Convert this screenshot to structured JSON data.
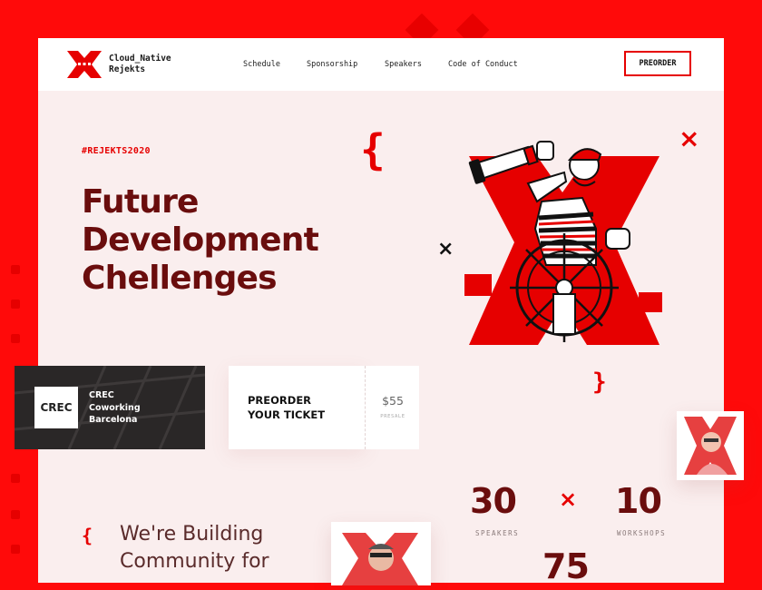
{
  "header": {
    "logo_line1": "Cloud_Native",
    "logo_line2": "Rejekts",
    "nav": [
      "Schedule",
      "Sponsorship",
      "Speakers",
      "Code of Conduct"
    ],
    "preorder_label": "PREORDER"
  },
  "hero": {
    "hashtag": "#REJEKTS2020",
    "title_lines": [
      "Future",
      "Development",
      "Chellenges"
    ]
  },
  "venue": {
    "logo_text": "CREC",
    "lines": [
      "CREC",
      "Coworking",
      "Barcelona"
    ]
  },
  "ticket": {
    "title_lines": [
      "PREORDER",
      "YOUR TICKET"
    ],
    "price": "$55",
    "presale": "PRESALE"
  },
  "stats": [
    {
      "value": "30",
      "label": "SPEAKERS"
    },
    {
      "value": "10",
      "label": "WORKSHOPS"
    },
    {
      "value": "75",
      "label": ""
    }
  ],
  "community": {
    "lines": [
      "We're Building",
      "Community for"
    ]
  },
  "decor": {
    "brace_open": "{",
    "brace_close": "}",
    "cross": "×"
  },
  "colors": {
    "brand_red": "#e60000",
    "title_dark_red": "#6a0d0d",
    "page_bg": "#faeeee"
  }
}
